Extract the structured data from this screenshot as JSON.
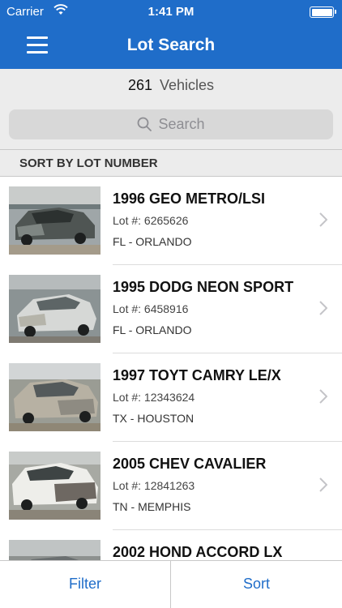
{
  "status_bar": {
    "carrier": "Carrier",
    "time": "1:41 PM"
  },
  "nav": {
    "title": "Lot Search"
  },
  "summary": {
    "count": "261",
    "label": "Vehicles"
  },
  "search": {
    "placeholder": "Search"
  },
  "sort_header": "SORT BY LOT NUMBER",
  "vehicles": [
    {
      "title": "1996 GEO METRO/LSI",
      "lot": "Lot #: 6265626",
      "location": "FL - ORLANDO"
    },
    {
      "title": "1995 DODG NEON SPORT",
      "lot": "Lot #: 6458916",
      "location": "FL - ORLANDO"
    },
    {
      "title": "1997 TOYT CAMRY LE/X",
      "lot": "Lot #: 12343624",
      "location": "TX - HOUSTON"
    },
    {
      "title": "2005 CHEV CAVALIER",
      "lot": "Lot #: 12841263",
      "location": "TN - MEMPHIS"
    },
    {
      "title": "2002 HOND ACCORD LX",
      "lot": "",
      "location": ""
    }
  ],
  "tabs": {
    "filter": "Filter",
    "sort": "Sort"
  },
  "colors": {
    "brand": "#1f6dc9",
    "background_gray": "#ececec"
  },
  "icons": {
    "menu": "hamburger-menu-icon",
    "search": "magnifier-icon",
    "chevron": "chevron-right-icon"
  }
}
